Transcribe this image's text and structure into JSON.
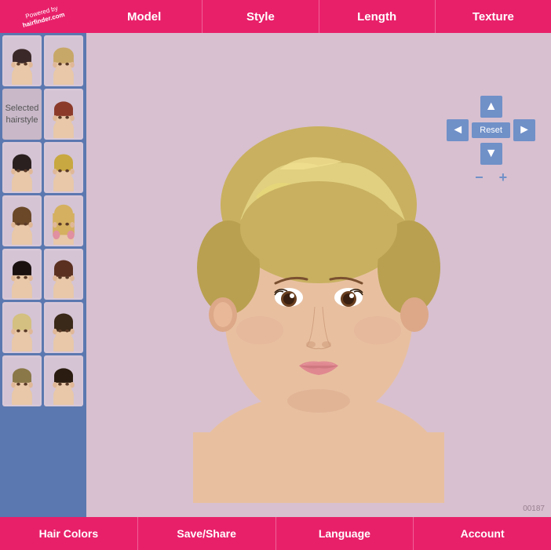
{
  "app": {
    "title": "HairFinder",
    "logo_line1": "Powered by",
    "logo_line2": "hairfinder.com"
  },
  "top_nav": {
    "items": [
      {
        "label": "Model",
        "id": "model"
      },
      {
        "label": "Style",
        "id": "style"
      },
      {
        "label": "Length",
        "id": "length"
      },
      {
        "label": "Texture",
        "id": "texture"
      }
    ]
  },
  "sidebar": {
    "selected_label": "Selected\nhairstyle",
    "thumbnails": [
      {
        "id": 1,
        "desc": "short dark pixie",
        "row": 0,
        "col": 0
      },
      {
        "id": 2,
        "desc": "short wavy",
        "row": 0,
        "col": 1
      },
      {
        "id": 3,
        "desc": "selected",
        "row": 1,
        "col": 0
      },
      {
        "id": 4,
        "desc": "short red bob",
        "row": 1,
        "col": 1
      },
      {
        "id": 5,
        "desc": "short dark bob",
        "row": 2,
        "col": 0
      },
      {
        "id": 6,
        "desc": "blonde highlights",
        "row": 2,
        "col": 1
      },
      {
        "id": 7,
        "desc": "short wavy brown",
        "row": 3,
        "col": 0
      },
      {
        "id": 8,
        "desc": "blonde pink long",
        "row": 3,
        "col": 1
      },
      {
        "id": 9,
        "desc": "short pixie dark",
        "row": 4,
        "col": 0
      },
      {
        "id": 10,
        "desc": "short brunette",
        "row": 4,
        "col": 1
      },
      {
        "id": 11,
        "desc": "blonde short",
        "row": 5,
        "col": 0
      },
      {
        "id": 12,
        "desc": "dark brown bob",
        "row": 5,
        "col": 1
      },
      {
        "id": 13,
        "desc": "short layered",
        "row": 6,
        "col": 0
      },
      {
        "id": 14,
        "desc": "short dark",
        "row": 6,
        "col": 1
      }
    ]
  },
  "controls": {
    "reset_label": "Reset",
    "up_arrow": "▲",
    "down_arrow": "▼",
    "left_arrow": "◄",
    "right_arrow": "►",
    "zoom_in": "+",
    "zoom_out": "−"
  },
  "preview": {
    "image_number": "00187"
  },
  "bottom_toolbar": {
    "items": [
      {
        "label": "Hair Colors",
        "id": "hair-colors"
      },
      {
        "label": "Save/Share",
        "id": "save-share"
      },
      {
        "label": "Language",
        "id": "language"
      },
      {
        "label": "Account",
        "id": "account"
      }
    ]
  }
}
